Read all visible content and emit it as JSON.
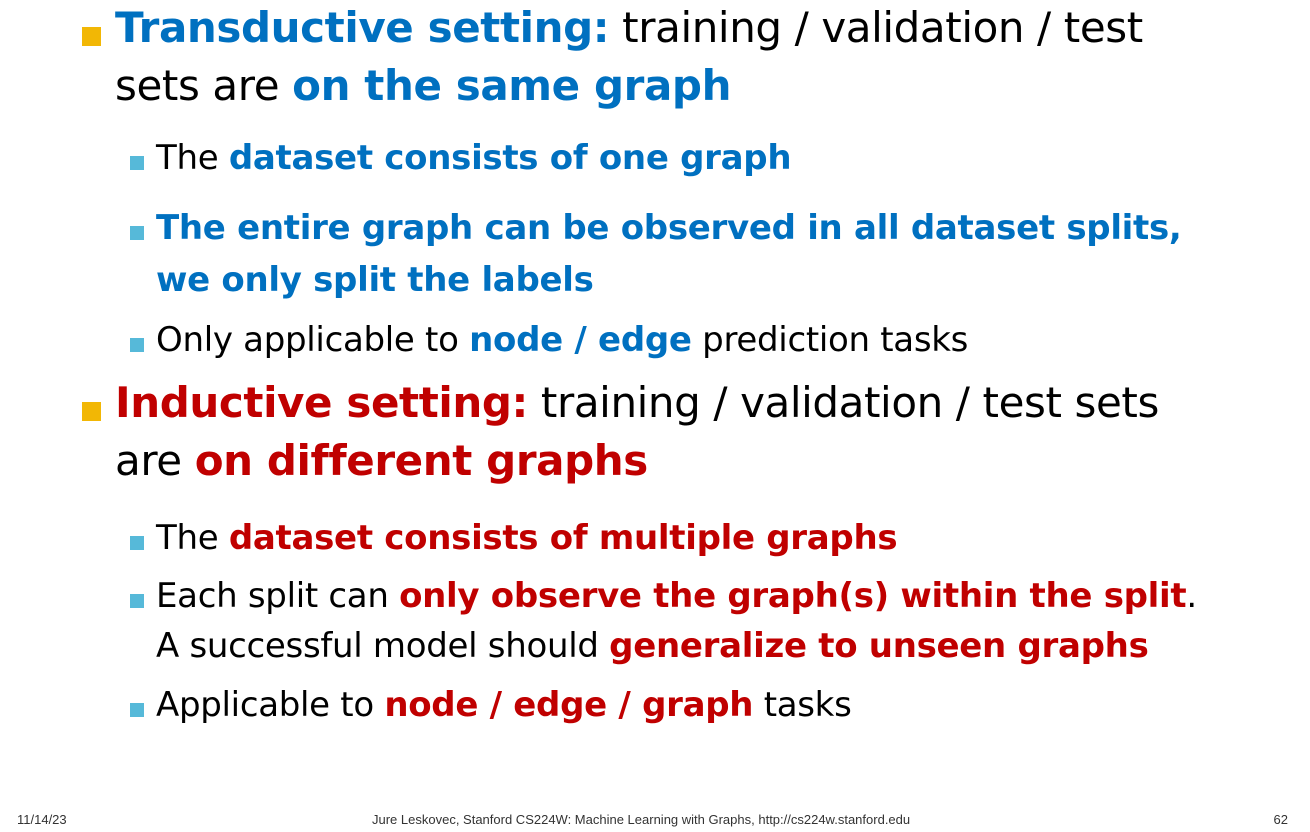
{
  "items": [
    {
      "level": 1,
      "lines": [
        [
          {
            "text": "Transductive setting:",
            "style": "blue"
          },
          {
            "text": " training / validation / test",
            "style": "normal"
          }
        ],
        [
          {
            "text": "sets are ",
            "style": "normal"
          },
          {
            "text": "on the same graph",
            "style": "blue"
          }
        ]
      ]
    },
    {
      "level": 2,
      "lines": [
        [
          {
            "text": "The ",
            "style": "normal"
          },
          {
            "text": "dataset consists of one graph",
            "style": "blue"
          }
        ]
      ]
    },
    {
      "level": 2,
      "lines": [
        [
          {
            "text": "The entire graph can be observed in all dataset splits,",
            "style": "blue"
          }
        ],
        [
          {
            "text": "we only split the labels",
            "style": "blue"
          }
        ]
      ]
    },
    {
      "level": 2,
      "lines": [
        [
          {
            "text": "Only applicable to ",
            "style": "normal"
          },
          {
            "text": "node / edge",
            "style": "blue"
          },
          {
            "text": " prediction tasks",
            "style": "normal"
          }
        ]
      ]
    },
    {
      "level": 1,
      "lines": [
        [
          {
            "text": "Inductive setting:",
            "style": "red"
          },
          {
            "text": " training / validation / test sets",
            "style": "normal"
          }
        ],
        [
          {
            "text": "are ",
            "style": "normal"
          },
          {
            "text": "on different graphs",
            "style": "red"
          }
        ]
      ]
    },
    {
      "level": 2,
      "lines": [
        [
          {
            "text": "The ",
            "style": "normal"
          },
          {
            "text": "dataset consists of multiple graphs",
            "style": "red"
          }
        ]
      ]
    },
    {
      "level": 2,
      "lines": [
        [
          {
            "text": "Each split can ",
            "style": "normal"
          },
          {
            "text": "only observe the graph(s) within the split",
            "style": "red"
          },
          {
            "text": ".",
            "style": "normal"
          }
        ],
        [
          {
            "text": "A successful model should ",
            "style": "normal"
          },
          {
            "text": "generalize to unseen graphs",
            "style": "red"
          }
        ]
      ]
    },
    {
      "level": 2,
      "lines": [
        [
          {
            "text": "Applicable to ",
            "style": "normal"
          },
          {
            "text": "node / edge / graph",
            "style": "red"
          },
          {
            "text": " tasks",
            "style": "normal"
          }
        ]
      ]
    }
  ],
  "footer": {
    "date": "11/14/23",
    "credit": "Jure Leskovec, Stanford CS224W: Machine Learning with Graphs, http://cs224w.stanford.edu",
    "page": "62"
  },
  "colors": {
    "blue_emphasis": "#0070c0",
    "red_emphasis": "#c00000",
    "level1_bullet": "#f2b705",
    "level2_bullet": "#56b9d9"
  }
}
